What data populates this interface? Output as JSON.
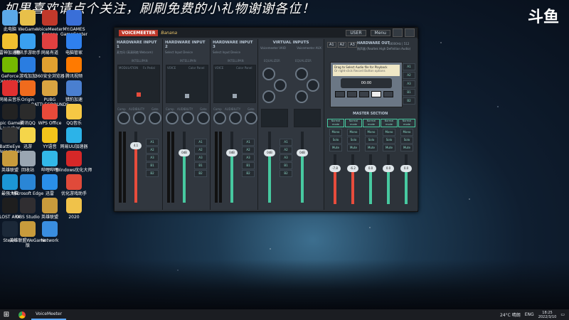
{
  "banner": "如果喜欢请点个关注，刷刷免费的小礼物谢谢各位！",
  "platform_logo": "斗鱼",
  "desktop_icons": [
    {
      "label": "此电脑",
      "icon": "computer-icon",
      "color": "#5ba8e8"
    },
    {
      "label": "WeGame",
      "icon": "wegame-icon",
      "color": "#e8c04a"
    },
    {
      "label": "VoiceMeeter Banana",
      "icon": "voicemeeter-icon",
      "color": "#c0392b"
    },
    {
      "label": "MY.GAMES GameCenter",
      "icon": "mygames-icon",
      "color": "#3a6fd8"
    },
    {
      "label": "雷神加速器",
      "icon": "leishen-icon",
      "color": "#f0c030"
    },
    {
      "label": "腾讯手游助手",
      "icon": "tencent-icon",
      "color": "#3aa0f0"
    },
    {
      "label": "网易有道",
      "icon": "youdao-icon",
      "color": "#e04040"
    },
    {
      "label": "电脑管家",
      "icon": "pcmanager-icon",
      "color": "#2f80ed"
    },
    {
      "label": "GeForce Experience",
      "icon": "nvidia-icon",
      "color": "#76b900"
    },
    {
      "label": "游戏加加",
      "icon": "gameplus-icon",
      "color": "#2a7de1"
    },
    {
      "label": "360安全浏览器",
      "icon": "browser360-icon",
      "color": "#e0a030"
    },
    {
      "label": "腾讯视频",
      "icon": "tencentvideo-icon",
      "color": "#ff7a00"
    },
    {
      "label": "网易云音乐",
      "icon": "netease-icon",
      "color": "#e03030"
    },
    {
      "label": "Origin",
      "icon": "origin-icon",
      "color": "#f06b1d"
    },
    {
      "label": "PUBG BATTLEGROUNDS",
      "icon": "pubg-icon",
      "color": "#d9a441"
    },
    {
      "label": "猎豹加速",
      "icon": "lebao-icon",
      "color": "#4a7fd0"
    },
    {
      "label": "Epic Games Launcher",
      "icon": "epic-icon",
      "color": "#222222"
    },
    {
      "label": "腾讯QQ",
      "icon": "qq-icon",
      "color": "#2b2b2b"
    },
    {
      "label": "WPS Office",
      "icon": "wps-icon",
      "color": "#e84a3a"
    },
    {
      "label": "QQ音乐",
      "icon": "qqmusic-icon",
      "color": "#f6c844"
    },
    {
      "label": "BattleEye Reinstaller",
      "icon": "battleye-icon",
      "color": "#333333"
    },
    {
      "label": "迅游",
      "icon": "xunyou-icon",
      "color": "#f5d54a"
    },
    {
      "label": "YY语音",
      "icon": "yy-icon",
      "color": "#f2c41b"
    },
    {
      "label": "网易UU加速器",
      "icon": "uu-icon",
      "color": "#2cb3e8"
    },
    {
      "label": "英雄联盟",
      "icon": "lol-icon",
      "color": "#c89b3c"
    },
    {
      "label": "回收站",
      "icon": "recycle-icon",
      "color": "#9aa6b2"
    },
    {
      "label": "哔哩哔哩",
      "icon": "bilibili-icon",
      "color": "#32b8e8"
    },
    {
      "label": "Windows优化大师",
      "icon": "optimizer-icon",
      "color": "#d62828"
    },
    {
      "label": "最强大脑",
      "icon": "brain-icon",
      "color": "#1c96d6"
    },
    {
      "label": "Microsoft Edge",
      "icon": "edge-icon",
      "color": "#2a86d6"
    },
    {
      "label": "迅雷",
      "icon": "xunlei-icon",
      "color": "#2a8fe8"
    },
    {
      "label": "优化游戏助手",
      "icon": "helper-icon",
      "color": "#e04a3a"
    },
    {
      "label": "LOST ARK",
      "icon": "lostark-icon",
      "color": "#1e1e1e"
    },
    {
      "label": "OBS Studio",
      "icon": "obs-icon",
      "color": "#302e31"
    },
    {
      "label": "英雄联盟",
      "icon": "lol2-icon",
      "color": "#c89b3c"
    },
    {
      "label": "2020",
      "icon": "folder-icon",
      "color": "#f0c24a"
    },
    {
      "label": "Steam",
      "icon": "steam-icon",
      "color": "#1b2838"
    },
    {
      "label": "英雄联盟WeGame版",
      "icon": "lolwegame-icon",
      "color": "#c89b3c"
    },
    {
      "label": "Network",
      "icon": "network-icon",
      "color": "#3a8ee0"
    }
  ],
  "voicemeeter": {
    "brand": "VOICEMEETER",
    "edition": "Banana",
    "menu_btn": "Menu",
    "user_btn": "USER",
    "strips": [
      {
        "title": "HARDWARE INPUT 1",
        "device": "麦克风 (高清网络 Webcam)",
        "pad": "INTELLIPAN",
        "mode": "MODULATION",
        "fx": "Fx Pedal",
        "gain": "4.1",
        "fader": "Fader Gain",
        "type": "Comp",
        "aud": "AUDIBILITY",
        "gate": "Gate"
      },
      {
        "title": "HARDWARE INPUT 2",
        "device": "Select Input Device",
        "pad": "INTELLIPAN",
        "mode": "VOICE",
        "fx": "Color Panel",
        "gain": "0dB",
        "fader": "Fader Gain",
        "type": "Comp",
        "aud": "AUDIBILITY",
        "gate": "Gate"
      },
      {
        "title": "HARDWARE INPUT 3",
        "device": "Select Input Device",
        "pad": "INTELLIPAN",
        "mode": "VOICE",
        "fx": "Color Panel",
        "gain": "0dB",
        "fader": "Fader Gain",
        "type": "Comp",
        "aud": "AUDIBILITY",
        "gate": "Gate"
      }
    ],
    "virtual": {
      "title": "VIRTUAL INPUTS",
      "a": "Voicemeeter VAIO",
      "b": "Voicemeeter AUX",
      "eq": "EQUALIZER",
      "fader": "Fader Gain",
      "gain": "0dB"
    },
    "outputs": {
      "a1": "A1",
      "a2": "A2",
      "a3": "A3",
      "title": "HARDWARE OUT",
      "info": "48000Hz | 512",
      "device": "扬声器 (Realtek High Definition Audio)"
    },
    "tape": {
      "msg": "Drag to Select Audio file for Playback",
      "sub": "Or right-click Record Button options",
      "time": "00:00",
      "label": "Record"
    },
    "master": {
      "title": "MASTER SECTION",
      "modes": [
        "Normal mode",
        "Normal mode",
        "Normal mode",
        "Normal mode",
        "Normal mode"
      ],
      "gains": [
        "-7.8",
        "-6.2",
        "0.0",
        "0.0",
        "0.0"
      ]
    },
    "bus_buttons": [
      "A1",
      "A2",
      "A3",
      "B1",
      "B2"
    ],
    "actions": [
      "Mono",
      "Solo",
      "Mute"
    ]
  },
  "taskbar": {
    "start": "⊞",
    "app": "VoiceMeeter",
    "weather": "24°C 晴朗",
    "lang": "ENG",
    "time": "18:25",
    "date": "2022/3/10"
  }
}
